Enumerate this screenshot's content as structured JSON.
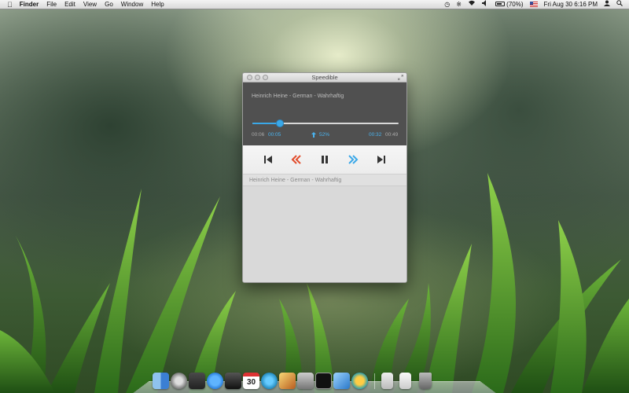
{
  "menubar": {
    "app_name": "Finder",
    "menus": [
      "File",
      "Edit",
      "View",
      "Go",
      "Window",
      "Help"
    ],
    "battery_percent": "(70%)",
    "datetime": "Fri Aug 30  6:16 PM"
  },
  "window": {
    "title": "Speedible",
    "track_title": "Heinrich Heine - German - Wahrhaftig",
    "time_left_total": "00:06",
    "time_elapsed": "00:05",
    "speed": "52%",
    "time_remaining": "00:32",
    "time_right_total": "00:49",
    "progress_fraction": 0.19
  },
  "playlist": {
    "items": [
      "Heinrich Heine - German - Wahrhaftig"
    ]
  },
  "dock": {
    "icons": [
      "finder-icon",
      "launchpad-icon",
      "mission-control-icon",
      "app-store-icon",
      "facetime-icon",
      "calendar-icon",
      "itunes-icon",
      "iphoto-icon",
      "utility-icon",
      "terminal-icon",
      "xcode-icon",
      "speedible-icon",
      "document-icon",
      "document-icon-2",
      "trash-icon"
    ],
    "calendar_day": "30"
  },
  "colors": {
    "accent": "#3aa8e8",
    "rewind": "#e24b2a",
    "player_bg": "#505050"
  }
}
